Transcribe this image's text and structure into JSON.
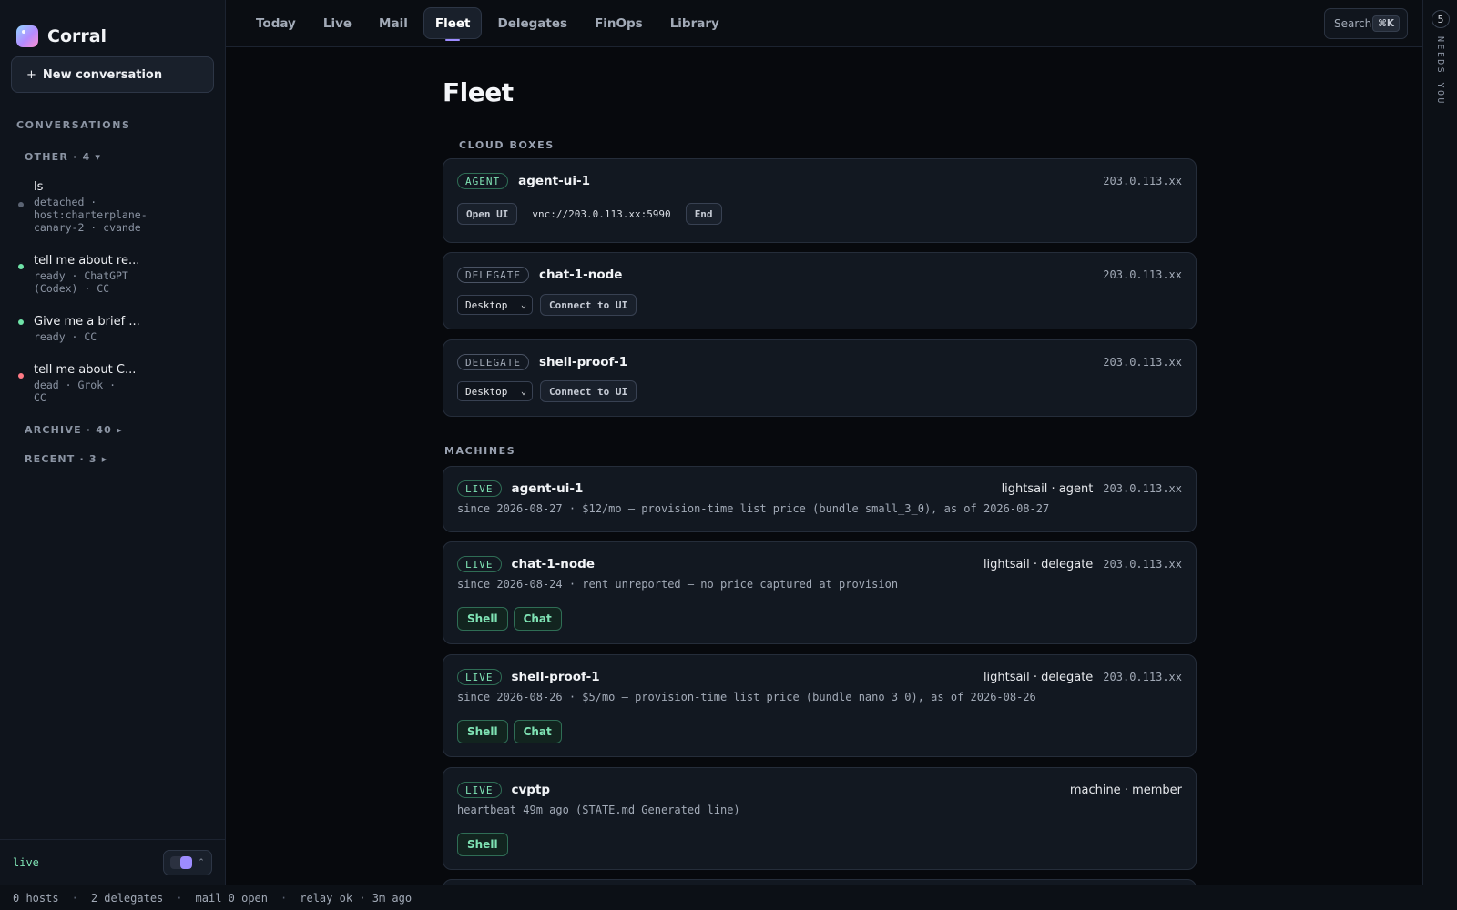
{
  "app": {
    "name": "Corral"
  },
  "sidebar": {
    "new_conversation": "New conversation",
    "conversations_label": "CONVERSATIONS",
    "groups": {
      "other": "OTHER · 4 ▾",
      "archive": "ARCHIVE · 40 ▸",
      "recent": "RECENT · 3 ▸"
    },
    "items": [
      {
        "title": "ls",
        "meta": [
          "detached ·",
          "host:charterplane-",
          "canary-2 · cvande"
        ],
        "status": "detached",
        "dot_color": "#5b6473"
      },
      {
        "title": "tell me about re...",
        "meta": [
          "ready · ChatGPT",
          "(Codex) · CC"
        ],
        "status": "ready",
        "dot_color": "#6fe3a8"
      },
      {
        "title": "Give me a brief ...",
        "meta": [
          "ready · CC"
        ],
        "status": "ready",
        "dot_color": "#6fe3a8"
      },
      {
        "title": "tell me about C...",
        "meta": [
          "dead · Grok ·",
          "CC"
        ],
        "status": "dead",
        "dot_color": "#ff7a85"
      }
    ],
    "footer": {
      "status": "live"
    }
  },
  "nav": {
    "tabs": [
      "Today",
      "Live",
      "Mail",
      "Fleet",
      "Delegates",
      "FinOps",
      "Library"
    ],
    "active": "Fleet",
    "search_label": "Search",
    "search_shortcut": "⌘K"
  },
  "rail": {
    "count": "5",
    "label": "NEEDS YOU"
  },
  "page": {
    "title": "Fleet"
  },
  "cloud_boxes": {
    "label": "CLOUD BOXES",
    "items": [
      {
        "badge": "AGENT",
        "name": "agent-ui-1",
        "ip": "203.0.113.xx",
        "open_label": "Open UI",
        "vnc": "vnc://203.0.113.xx:5990",
        "end_label": "End"
      },
      {
        "badge": "DELEGATE",
        "name": "chat-1-node",
        "ip": "203.0.113.xx",
        "select": "Desktop",
        "connect_label": "Connect to UI"
      },
      {
        "badge": "DELEGATE",
        "name": "shell-proof-1",
        "ip": "203.0.113.xx",
        "select": "Desktop",
        "connect_label": "Connect to UI"
      }
    ]
  },
  "machines": {
    "label": "MACHINES",
    "items": [
      {
        "badge": "LIVE",
        "name": "agent-ui-1",
        "kind": "lightsail · agent",
        "ip": "203.0.113.xx",
        "meta": "since 2026-08-27 · $12/mo — provision-time list price (bundle small_3_0), as of 2026-08-27"
      },
      {
        "badge": "LIVE",
        "name": "chat-1-node",
        "kind": "lightsail · delegate",
        "ip": "203.0.113.xx",
        "meta": "since 2026-08-24 · rent unreported — no price captured at provision",
        "buttons": [
          "Shell",
          "Chat"
        ]
      },
      {
        "badge": "LIVE",
        "name": "shell-proof-1",
        "kind": "lightsail · delegate",
        "ip": "203.0.113.xx",
        "meta": "since 2026-08-26 · $5/mo — provision-time list price (bundle nano_3_0), as of 2026-08-26",
        "buttons": [
          "Shell",
          "Chat"
        ]
      },
      {
        "badge": "LIVE",
        "name": "cvptp",
        "kind": "machine · member",
        "ip": "",
        "meta": "heartbeat 49m ago (STATE.md Generated line)",
        "buttons": [
          "Shell"
        ]
      }
    ]
  },
  "statusbar": {
    "hosts": "0 hosts",
    "delegates": "2 delegates",
    "mail": "mail 0 open",
    "relay": "relay ok · 3m ago"
  }
}
